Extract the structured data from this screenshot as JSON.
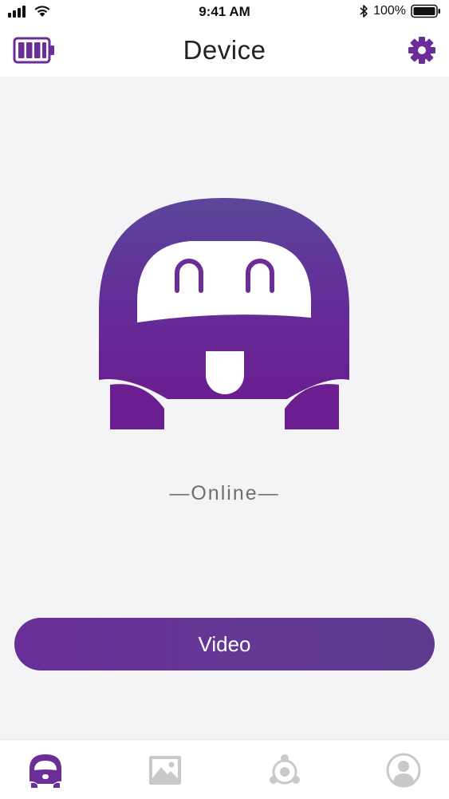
{
  "status_bar": {
    "time": "9:41 AM",
    "battery_percent": "100%",
    "signal_icon": "signal-bars-icon",
    "wifi_icon": "wifi-icon",
    "bluetooth_icon": "bluetooth-icon",
    "battery_icon": "battery-icon"
  },
  "header": {
    "title": "Device",
    "left_icon": "battery-level-icon",
    "right_icon": "gear-icon"
  },
  "device": {
    "illustration": "robot-icon",
    "status": "—Online—"
  },
  "actions": {
    "video_label": "Video"
  },
  "tab_bar": {
    "tabs": [
      {
        "icon": "robot-tab-icon",
        "active": true
      },
      {
        "icon": "gallery-icon",
        "active": false
      },
      {
        "icon": "share-icon",
        "active": false
      },
      {
        "icon": "profile-icon",
        "active": false
      }
    ]
  },
  "colors": {
    "accent": "#6b2d98",
    "inactive_icon": "#c9c9c9",
    "background": "#f4f3f6"
  }
}
